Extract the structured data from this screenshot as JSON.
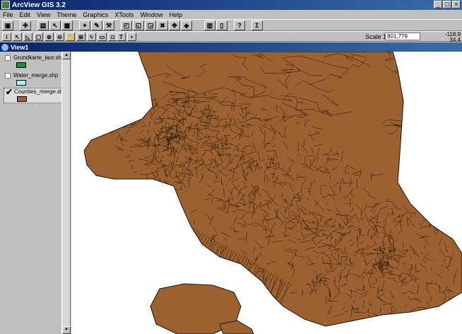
{
  "app": {
    "title": "ArcView GIS 3.2",
    "window_buttons": [
      "_",
      "□",
      "×"
    ]
  },
  "menus": [
    "File",
    "Edit",
    "View",
    "Theme",
    "Graphics",
    "XTools",
    "Window",
    "Help"
  ],
  "toolbar": {
    "scale_label": "Scale 1:",
    "scale_value": "801,779",
    "coord_x": "-118.9",
    "coord_y": "34.4",
    "query_label": "?",
    "sigma_label": "Σ",
    "info_label": "i",
    "text_tool_label": "T"
  },
  "view": {
    "title": "View1"
  },
  "toc": {
    "layers": [
      {
        "name": "Grundkarte_laor.sh",
        "checked": false,
        "color": "#1a8a3c"
      },
      {
        "name": "Water_merge.shp",
        "checked": false,
        "color": "#aaf0f0"
      },
      {
        "name": "Counties_merge.sh",
        "checked": true,
        "color": "#9c6130",
        "check_mark": "✔"
      }
    ]
  },
  "colors": {
    "polygon_fill": "#9c6130",
    "polygon_stroke": "#1e1408"
  }
}
